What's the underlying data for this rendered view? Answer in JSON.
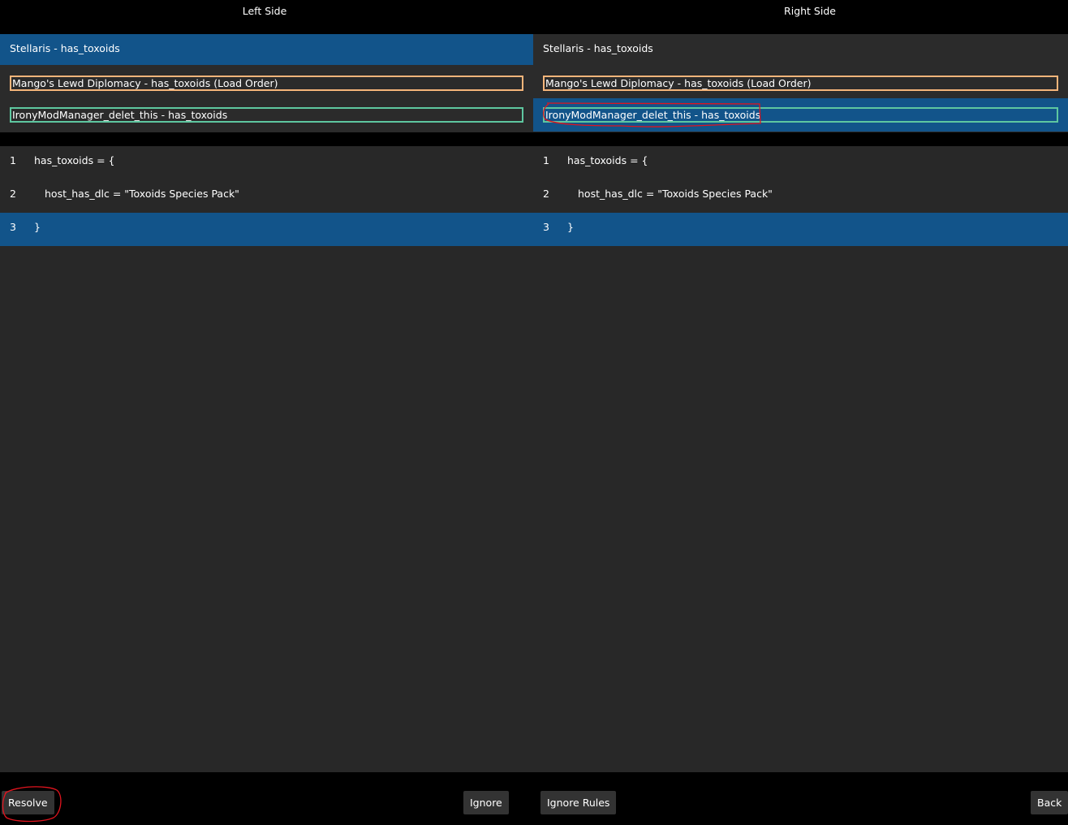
{
  "headers": {
    "left": "Left Side",
    "right": "Right Side"
  },
  "left_list": [
    {
      "label": "Stellaris - has_toxoids",
      "selected": true
    },
    {
      "label": "Mango's Lewd Diplomacy - has_toxoids (Load Order)",
      "border": "#f5b57a"
    },
    {
      "label": "IronyModManager_delet_this - has_toxoids",
      "border": "#5ec7a0"
    }
  ],
  "right_list": [
    {
      "label": "Stellaris - has_toxoids"
    },
    {
      "label": "Mango's Lewd Diplomacy - has_toxoids (Load Order)",
      "border": "#f5b57a"
    },
    {
      "label": "IronyModManager_delet_this - has_toxoids",
      "border": "#5ec7a0",
      "selected": true
    }
  ],
  "left_code": [
    {
      "num": "1",
      "text": "has_toxoids = {"
    },
    {
      "num": "2",
      "text": "host_has_dlc = \"Toxoids Species Pack\""
    },
    {
      "num": "3",
      "text": "}"
    }
  ],
  "right_code": [
    {
      "num": "1",
      "text": "has_toxoids = {"
    },
    {
      "num": "2",
      "text": "host_has_dlc = \"Toxoids Species Pack\""
    },
    {
      "num": "3",
      "text": "}"
    }
  ],
  "buttons": {
    "resolve": "Resolve",
    "ignore": "Ignore",
    "ignore_rules": "Ignore Rules",
    "back": "Back"
  },
  "colors": {
    "selection": "#12548a",
    "panel": "#2b2b2b",
    "annotation": "#e0141e"
  }
}
